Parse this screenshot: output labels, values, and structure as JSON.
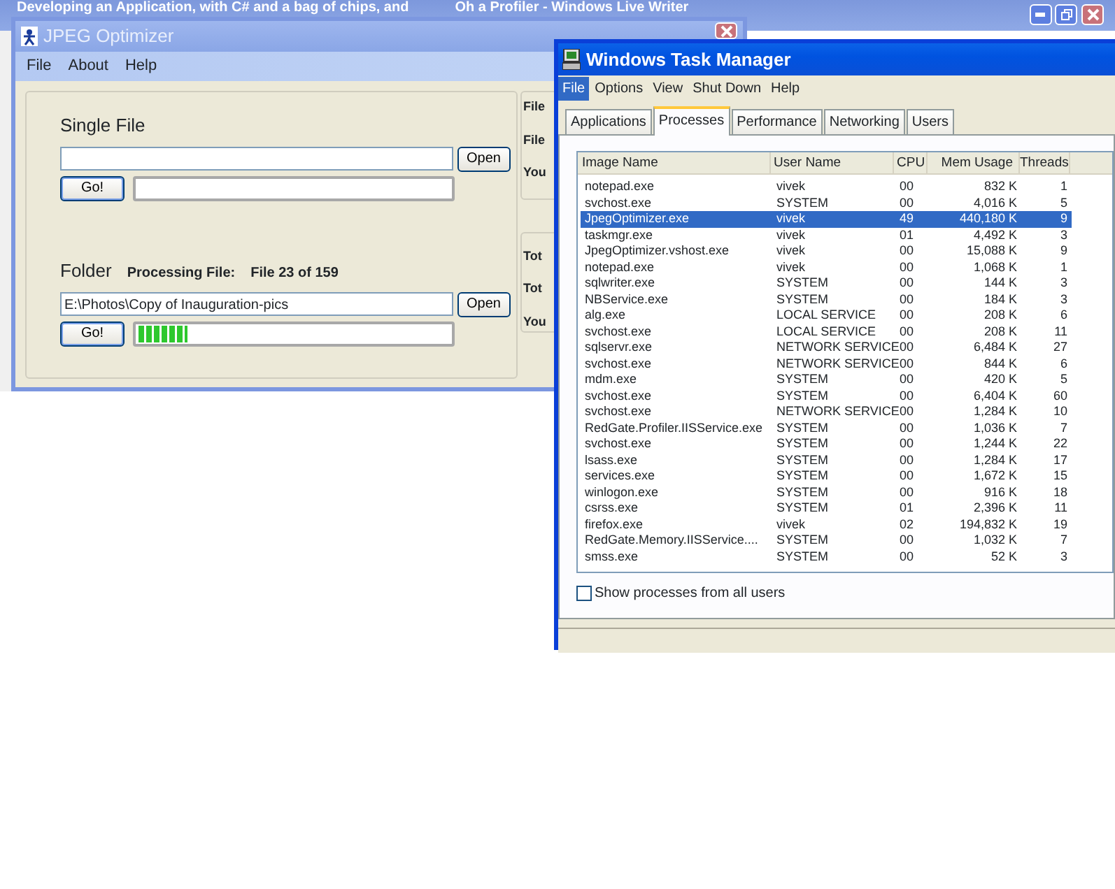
{
  "background_window": {
    "title_parts": [
      "Developing an Application, with C# and a bag of chips, and",
      "Oh a Profiler - Windows Live Writer"
    ]
  },
  "jpeg_optimizer": {
    "title": "JPEG Optimizer",
    "menu": [
      "File",
      "About",
      "Help"
    ],
    "single_file": {
      "heading": "Single File",
      "open_button": "Open",
      "go_button": "Go!"
    },
    "folder": {
      "heading": "Folder",
      "status_label": "Processing File:",
      "status_value": "File 23 of 159",
      "path": "E:\\Photos\\Copy of Inauguration-pics",
      "open_button": "Open",
      "go_button": "Go!",
      "progress": {
        "level": 0.16
      }
    },
    "side_labels_upper": [
      "File",
      "File",
      "You"
    ],
    "side_labels_lower": [
      "Tot",
      "Tot",
      "You"
    ]
  },
  "task_manager": {
    "title": "Windows Task Manager",
    "menu": [
      {
        "label": "File",
        "selected": true
      },
      {
        "label": "Options",
        "selected": false
      },
      {
        "label": "View",
        "selected": false
      },
      {
        "label": "Shut Down",
        "selected": false
      },
      {
        "label": "Help",
        "selected": false
      }
    ],
    "tabs": [
      {
        "label": "Applications",
        "selected": false
      },
      {
        "label": "Processes",
        "selected": true
      },
      {
        "label": "Performance",
        "selected": false
      },
      {
        "label": "Networking",
        "selected": false
      },
      {
        "label": "Users",
        "selected": false
      }
    ],
    "columns": [
      "Image Name",
      "User Name",
      "CPU",
      "Mem Usage",
      "Threads"
    ],
    "rows": [
      {
        "cells": [
          "notepad.exe",
          "vivek",
          "00",
          "832 K",
          "1"
        ],
        "selected": false
      },
      {
        "cells": [
          "svchost.exe",
          "SYSTEM",
          "00",
          "4,016 K",
          "5"
        ],
        "selected": false
      },
      {
        "cells": [
          "JpegOptimizer.exe",
          "vivek",
          "49",
          "440,180 K",
          "9"
        ],
        "selected": true
      },
      {
        "cells": [
          "taskmgr.exe",
          "vivek",
          "01",
          "4,492 K",
          "3"
        ],
        "selected": false
      },
      {
        "cells": [
          "JpegOptimizer.vshost.exe",
          "vivek",
          "00",
          "15,088 K",
          "9"
        ],
        "selected": false
      },
      {
        "cells": [
          "notepad.exe",
          "vivek",
          "00",
          "1,068 K",
          "1"
        ],
        "selected": false
      },
      {
        "cells": [
          "sqlwriter.exe",
          "SYSTEM",
          "00",
          "144 K",
          "3"
        ],
        "selected": false
      },
      {
        "cells": [
          "NBService.exe",
          "SYSTEM",
          "00",
          "184 K",
          "3"
        ],
        "selected": false
      },
      {
        "cells": [
          "alg.exe",
          "LOCAL SERVICE",
          "00",
          "208 K",
          "6"
        ],
        "selected": false
      },
      {
        "cells": [
          "svchost.exe",
          "LOCAL SERVICE",
          "00",
          "208 K",
          "11"
        ],
        "selected": false
      },
      {
        "cells": [
          "sqlservr.exe",
          "NETWORK SERVICE",
          "00",
          "6,484 K",
          "27"
        ],
        "selected": false
      },
      {
        "cells": [
          "svchost.exe",
          "NETWORK SERVICE",
          "00",
          "844 K",
          "6"
        ],
        "selected": false
      },
      {
        "cells": [
          "mdm.exe",
          "SYSTEM",
          "00",
          "420 K",
          "5"
        ],
        "selected": false
      },
      {
        "cells": [
          "svchost.exe",
          "SYSTEM",
          "00",
          "6,404 K",
          "60"
        ],
        "selected": false
      },
      {
        "cells": [
          "svchost.exe",
          "NETWORK SERVICE",
          "00",
          "1,284 K",
          "10"
        ],
        "selected": false
      },
      {
        "cells": [
          "RedGate.Profiler.IISService.exe",
          "SYSTEM",
          "00",
          "1,036 K",
          "7"
        ],
        "selected": false
      },
      {
        "cells": [
          "svchost.exe",
          "SYSTEM",
          "00",
          "1,244 K",
          "22"
        ],
        "selected": false
      },
      {
        "cells": [
          "lsass.exe",
          "SYSTEM",
          "00",
          "1,284 K",
          "17"
        ],
        "selected": false
      },
      {
        "cells": [
          "services.exe",
          "SYSTEM",
          "00",
          "1,672 K",
          "15"
        ],
        "selected": false
      },
      {
        "cells": [
          "winlogon.exe",
          "SYSTEM",
          "00",
          "916 K",
          "18"
        ],
        "selected": false
      },
      {
        "cells": [
          "csrss.exe",
          "SYSTEM",
          "01",
          "2,396 K",
          "11"
        ],
        "selected": false
      },
      {
        "cells": [
          "firefox.exe",
          "vivek",
          "02",
          "194,832 K",
          "19"
        ],
        "selected": false
      },
      {
        "cells": [
          "RedGate.Memory.IISService....",
          "SYSTEM",
          "00",
          "1,032 K",
          "7"
        ],
        "selected": false
      },
      {
        "cells": [
          "smss.exe",
          "SYSTEM",
          "00",
          "52 K",
          "3"
        ],
        "selected": false
      }
    ],
    "show_all_users": {
      "label": "Show processes from all users",
      "checked": false
    }
  }
}
